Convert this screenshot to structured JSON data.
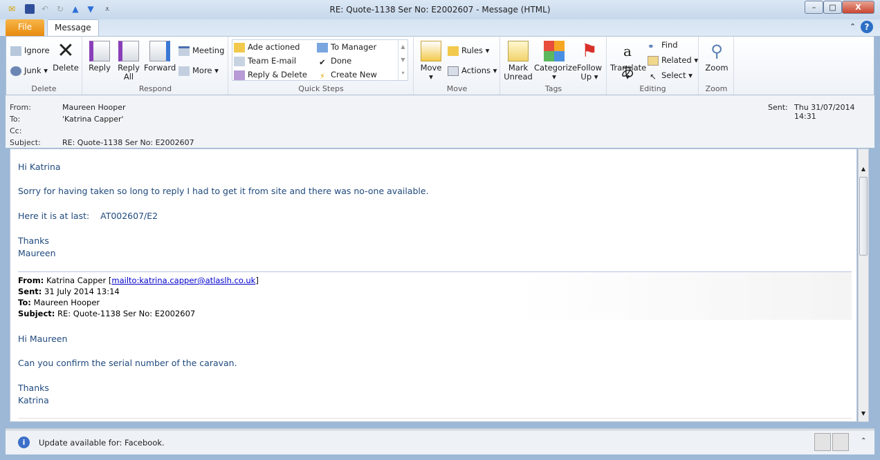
{
  "window": {
    "title": "RE: Quote-1138  Ser No:  E2002607  -  Message (HTML)",
    "minimize": "–",
    "maximize": "□",
    "close": "X"
  },
  "tabs": [
    {
      "label": "File"
    },
    {
      "label": "Message"
    }
  ],
  "ribbon": {
    "delete": {
      "label": "Delete",
      "ignore": "Ignore",
      "junk": "Junk",
      "delete": "Delete"
    },
    "respond": {
      "label": "Respond",
      "reply": "Reply",
      "reply_all_1": "Reply",
      "reply_all_2": "All",
      "forward": "Forward",
      "meeting": "Meeting",
      "more": "More"
    },
    "quick_steps": {
      "label": "Quick Steps",
      "items": [
        "Ade actioned",
        "To Manager",
        "Team E-mail",
        "Done",
        "Reply & Delete",
        "Create New"
      ]
    },
    "move": {
      "label": "Move",
      "move": "Move",
      "rules": "Rules",
      "actions": "Actions"
    },
    "tags": {
      "label": "Tags",
      "mark_1": "Mark",
      "mark_2": "Unread",
      "categorize": "Categorize",
      "follow_1": "Follow",
      "follow_2": "Up"
    },
    "editing": {
      "label": "Editing",
      "translate": "Translate",
      "find": "Find",
      "related": "Related",
      "select": "Select"
    },
    "zoom": {
      "label": "Zoom",
      "zoom": "Zoom"
    }
  },
  "header": {
    "from_label": "From:",
    "from": "Maureen Hooper",
    "to_label": "To:",
    "to": "'Katrina Capper'",
    "cc_label": "Cc:",
    "subject_label": "Subject:",
    "subject": "RE: Quote-1138  Ser No:  E2002607",
    "sent_label": "Sent:",
    "sent": "Thu 31/07/2014 14:31"
  },
  "body": {
    "lines": [
      "Hi Katrina",
      "Sorry for having taken so long to reply I had to get it from site and there was no-one available.",
      "Here it is at last:    AT002607/E2",
      "Thanks",
      "Maureen"
    ],
    "quoted": {
      "from_label": "From:",
      "from": "Katrina Capper [",
      "mailto": "mailto:katrina.capper@atlaslh.co.uk",
      "from_end": "]",
      "sent_label": "Sent:",
      "sent": "31 July 2014 13:14",
      "to_label": "To:",
      "to": "Maureen Hooper",
      "subject_label": "Subject:",
      "subject": "RE: Quote-1138 Ser No: E2002607"
    },
    "lines2": [
      "Hi Maureen",
      "Can you confirm the serial number of the caravan.",
      "Thanks",
      "Katrina"
    ]
  },
  "status": {
    "text": "Update available for: Facebook."
  }
}
